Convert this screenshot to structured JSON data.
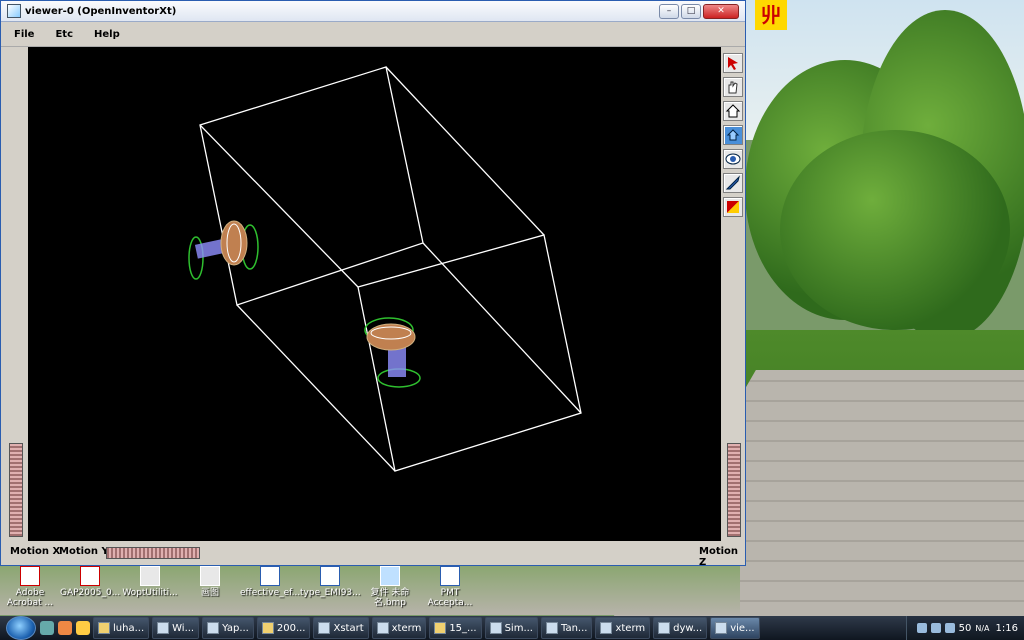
{
  "window": {
    "title": "viewer-0 (OpenInventorXt)",
    "controls": [
      "–",
      "□",
      "✕"
    ]
  },
  "menu": [
    "File",
    "Etc",
    "Help"
  ],
  "viewer": {
    "tools": [
      "select-pointer-icon",
      "hand-view-icon",
      "home-icon",
      "set-home-icon",
      "view-all-icon",
      "seek-icon",
      "projection-icon"
    ],
    "motion_x_label": "Motion X",
    "motion_y_label": "Motion Y",
    "motion_z_label": "Motion Z"
  },
  "desktop_icons": [
    {
      "label": "Adobe Acrobat ...",
      "icon": "pdf-icon"
    },
    {
      "label": "GAP2005_0...",
      "icon": "pdf-icon"
    },
    {
      "label": "WoptUtiliti...",
      "icon": "shortcut-icon"
    },
    {
      "label": "画图",
      "icon": "paint-icon"
    },
    {
      "label": "effective_ef...",
      "icon": "document-icon"
    },
    {
      "label": "type_EMI93...",
      "icon": "document-icon"
    },
    {
      "label": "复件 未命名.bmp",
      "icon": "image-icon"
    },
    {
      "label": "PMT Accepta...",
      "icon": "document-icon"
    }
  ],
  "tray_badge": "丱",
  "taskbar": {
    "items": [
      {
        "label": "luha...",
        "icon": "folder-icon"
      },
      {
        "label": "Wi...",
        "icon": "app-icon"
      },
      {
        "label": "Yap...",
        "icon": "app-icon"
      },
      {
        "label": "200...",
        "icon": "folder-icon"
      },
      {
        "label": "Xstart",
        "icon": "app-icon"
      },
      {
        "label": "xterm",
        "icon": "terminal-icon"
      },
      {
        "label": "15_...",
        "icon": "folder-icon"
      },
      {
        "label": "Sim...",
        "icon": "app-icon"
      },
      {
        "label": "Tan...",
        "icon": "app-icon"
      },
      {
        "label": "xterm",
        "icon": "terminal-icon"
      },
      {
        "label": "dyw...",
        "icon": "app-icon"
      },
      {
        "label": "vie...",
        "icon": "app-icon",
        "active": true
      }
    ],
    "tray_text": "50",
    "tray_text2": "N/A",
    "clock": "1:16"
  }
}
